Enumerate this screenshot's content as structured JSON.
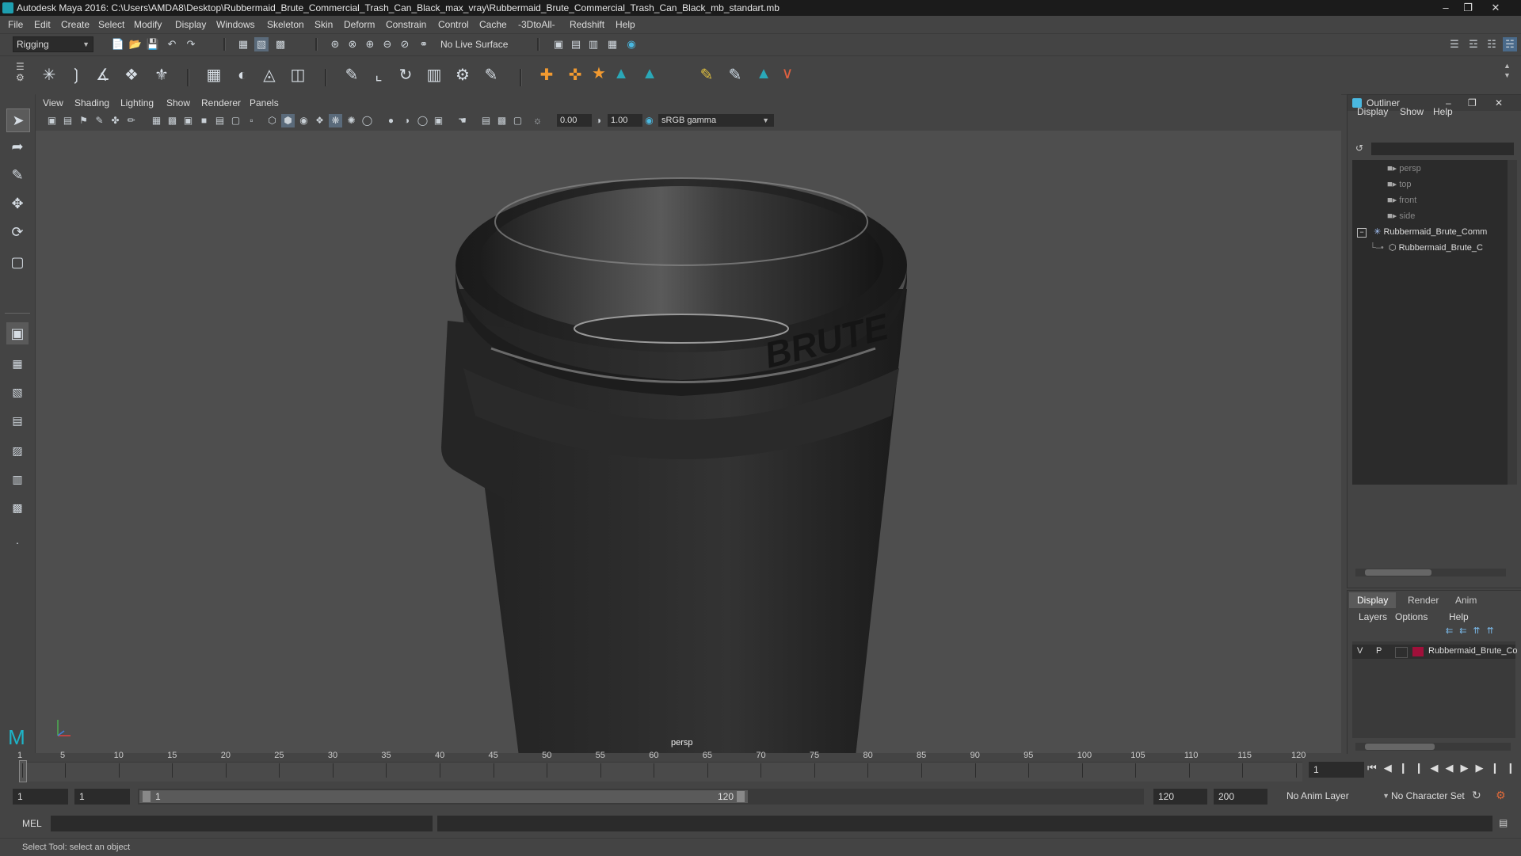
{
  "window": {
    "title": "Autodesk Maya 2016: C:\\Users\\AMDA8\\Desktop\\Rubbermaid_Brute_Commercial_Trash_Can_Black_max_vray\\Rubbermaid_Brute_Commercial_Trash_Can_Black_mb_standart.mb"
  },
  "menubar": [
    "File",
    "Edit",
    "Create",
    "Select",
    "Modify",
    "Display",
    "Windows",
    "Skeleton",
    "Skin",
    "Deform",
    "Constrain",
    "Control",
    "Cache",
    "-3DtoAll-",
    "Redshift",
    "Help"
  ],
  "statusline": {
    "menuset": "Rigging",
    "live_surface": "No Live Surface"
  },
  "viewport": {
    "menus": [
      "View",
      "Shading",
      "Lighting",
      "Show",
      "Renderer",
      "Panels"
    ],
    "exposure": "0.00",
    "gamma": "1.00",
    "color_space": "sRGB gamma",
    "camera_label": "persp",
    "model_logo": "BRUTE"
  },
  "outliner": {
    "title": "Outliner",
    "menus": [
      "Display",
      "Show",
      "Help"
    ],
    "items": [
      {
        "label": "persp",
        "type": "camera"
      },
      {
        "label": "top",
        "type": "camera"
      },
      {
        "label": "front",
        "type": "camera"
      },
      {
        "label": "side",
        "type": "camera"
      },
      {
        "label": "Rubbermaid_Brute_Comm",
        "type": "group"
      },
      {
        "label": "Rubbermaid_Brute_C",
        "type": "mesh"
      }
    ]
  },
  "layer_editor": {
    "tabs": [
      "Display",
      "Render",
      "Anim"
    ],
    "active_tab": "Display",
    "menus": [
      "Layers",
      "Options",
      "Help"
    ],
    "layer": {
      "v": "V",
      "p": "P",
      "name": "Rubbermaid_Brute_Co",
      "color": "#a0103a"
    }
  },
  "timeline": {
    "ticks": [
      "1",
      "5",
      "10",
      "15",
      "20",
      "25",
      "30",
      "35",
      "40",
      "45",
      "50",
      "55",
      "60",
      "65",
      "70",
      "75",
      "80",
      "85",
      "90",
      "95",
      "100",
      "105",
      "110",
      "115",
      "120"
    ],
    "current_frame": "1"
  },
  "range": {
    "start": "1",
    "playback_start": "1",
    "slider_start": "1",
    "slider_end": "120",
    "playback_end": "120",
    "end": "200",
    "anim_layer": "No Anim Layer",
    "character_set": "No Character Set"
  },
  "command_line": {
    "lang": "MEL"
  },
  "help_line": "Select Tool: select an object"
}
